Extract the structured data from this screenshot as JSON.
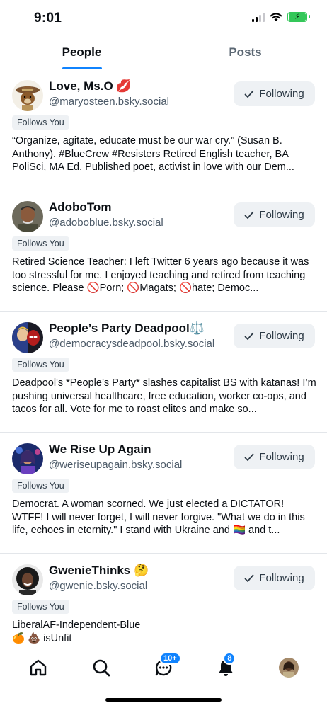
{
  "status": {
    "time": "9:01"
  },
  "tabs": [
    {
      "label": "People"
    },
    {
      "label": "Posts"
    }
  ],
  "people": [
    {
      "name": "Love, Ms.O 💋",
      "handle": "@maryosteen.bsky.social",
      "button": "Following",
      "badge": "Follows You",
      "bio": "“Organize, agitate, educate must be our war cry.” (Susan B. Anthony). #BlueCrew #Resisters Retired English teacher, BA PoliSci,  MA Ed.  Published poet, activist in love with our Dem..."
    },
    {
      "name": "AdoboTom",
      "handle": "@adoboblue.bsky.social",
      "button": "Following",
      "badge": "Follows You",
      "bio": "Retired Science Teacher: I left Twitter 6 years ago because it was too stressful for me. I enjoyed teaching and retired from teaching science. Please 🚫Porn; 🚫Magats; 🚫hate; Democ..."
    },
    {
      "name": "People’s Party Deadpool⚖️",
      "handle": "@democracysdeadpool.bsky.social",
      "button": "Following",
      "badge": "Follows You",
      "bio": "Deadpool's *People’s Party* slashes capitalist BS with katanas! I’m pushing universal healthcare, free education, worker co-ops, and tacos for all. Vote for me to roast elites and make so..."
    },
    {
      "name": "We Rise Up Again",
      "handle": "@weriseupagain.bsky.social",
      "button": "Following",
      "badge": "Follows You",
      "bio": "Democrat. A woman scorned. We just elected a DICTATOR! WTFF! I will never forget, I will never forgive. \"What we do in this life, echoes in eternity.\" I stand with Ukraine and 🏳️‍🌈 and t..."
    },
    {
      "name": "GwenieThinks 🤔",
      "handle": "@gwenie.bsky.social",
      "button": "Following",
      "badge": "Follows You",
      "bio": "LiberalAF-Independent-Blue\n🍊 💩 isUnfit"
    }
  ],
  "nav": {
    "chat_badge": "10+",
    "notif_badge": "8"
  },
  "colors": {
    "accent": "#1083fe",
    "badge_bg": "#eef1f4"
  },
  "icons": [
    "home-icon",
    "search-icon",
    "chat-icon",
    "bell-icon",
    "check-icon"
  ]
}
